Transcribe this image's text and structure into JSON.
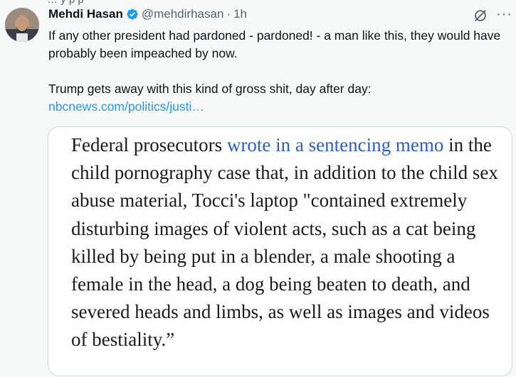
{
  "tweet": {
    "top_clipped_text": "… y p    p",
    "author_name": "Mehdi Hasan",
    "handle": "@mehdirhasan",
    "separator": "·",
    "time": "1h",
    "text_line1": "If any other president had pardoned - pardoned! - a man like this, they would have probably been impeached by now.",
    "text_line2": "Trump gets away with this kind of gross shit, day after day:",
    "link_text": "nbcnews.com/politics/justi…",
    "more_label": "···"
  },
  "card": {
    "quote_before_link": "Federal prosecutors ",
    "quote_link": "wrote in a sentencing memo",
    "quote_after_link": " in the child pornography case that, in addition to the child sex abuse material, Tocci's laptop \"contained extremely disturbing images of violent acts, such as a cat being killed by being put in a blender, a male shooting a female in the head, a dog being beaten to death, and severed heads and limbs, as well as images and videos of bestiality.”"
  },
  "icons": {
    "verified": "verified-badge-icon",
    "grok": "grok-icon",
    "more": "more-icon",
    "avatar": "avatar"
  },
  "colors": {
    "verified": "#1d9bf0",
    "link": "#1d9bf0",
    "quote_link": "#2b5fc4",
    "background": "#f7f9f9"
  }
}
